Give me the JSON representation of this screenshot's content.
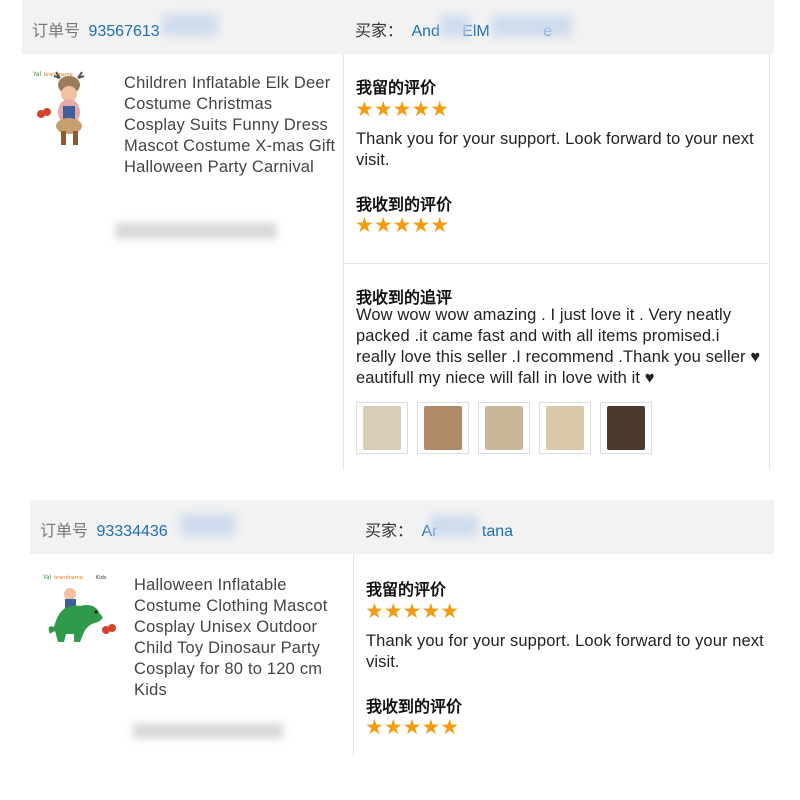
{
  "orders": [
    {
      "order_label": "订单号",
      "order_number": "93567613",
      "buyer_label": "买家：",
      "buyer_name_start": "And",
      "buyer_name_mid": "ElM",
      "buyer_name_end": "e",
      "product_title": "Children Inflatable Elk Deer Costume Christmas Cosplay Suits Funny Dress Mascot Costume X-mas Gift Halloween Party Carnival",
      "my_review_title": "我留的评价",
      "my_review_stars": "★★★★★",
      "my_review_text": "Thank you for your support. Look forward to your next visit.",
      "received_review_title": "我收到的评价",
      "received_review_stars": "★★★★★",
      "followup_title": "我收到的追评",
      "followup_text": "Wow wow wow amazing . I just love it . Very neatly packed .it came fast and with all items promised.i really love this seller .I recommend .Thank you seller ♥ eautifull my niece will fall in love with it ♥",
      "thumb_colors": [
        "#d9cdb5",
        "#b08a66",
        "#c9b79a",
        "#d8c7a8",
        "#4a3a2c"
      ]
    },
    {
      "order_label": "订单号",
      "order_number": "93334436",
      "buyer_label": "买家：",
      "buyer_name_start": "Ar",
      "buyer_name_end": "tana",
      "product_title": "Halloween Inflatable Costume Clothing Mascot Cosplay Unisex Outdoor Child Toy Dinosaur Party Cosplay for 80 to 120 cm Kids",
      "my_review_title": "我留的评价",
      "my_review_stars": "★★★★★",
      "my_review_text": "Thank you for your support. Look forward to your next visit.",
      "received_review_title": "我收到的评价",
      "received_review_stars": "★★★★★"
    }
  ]
}
